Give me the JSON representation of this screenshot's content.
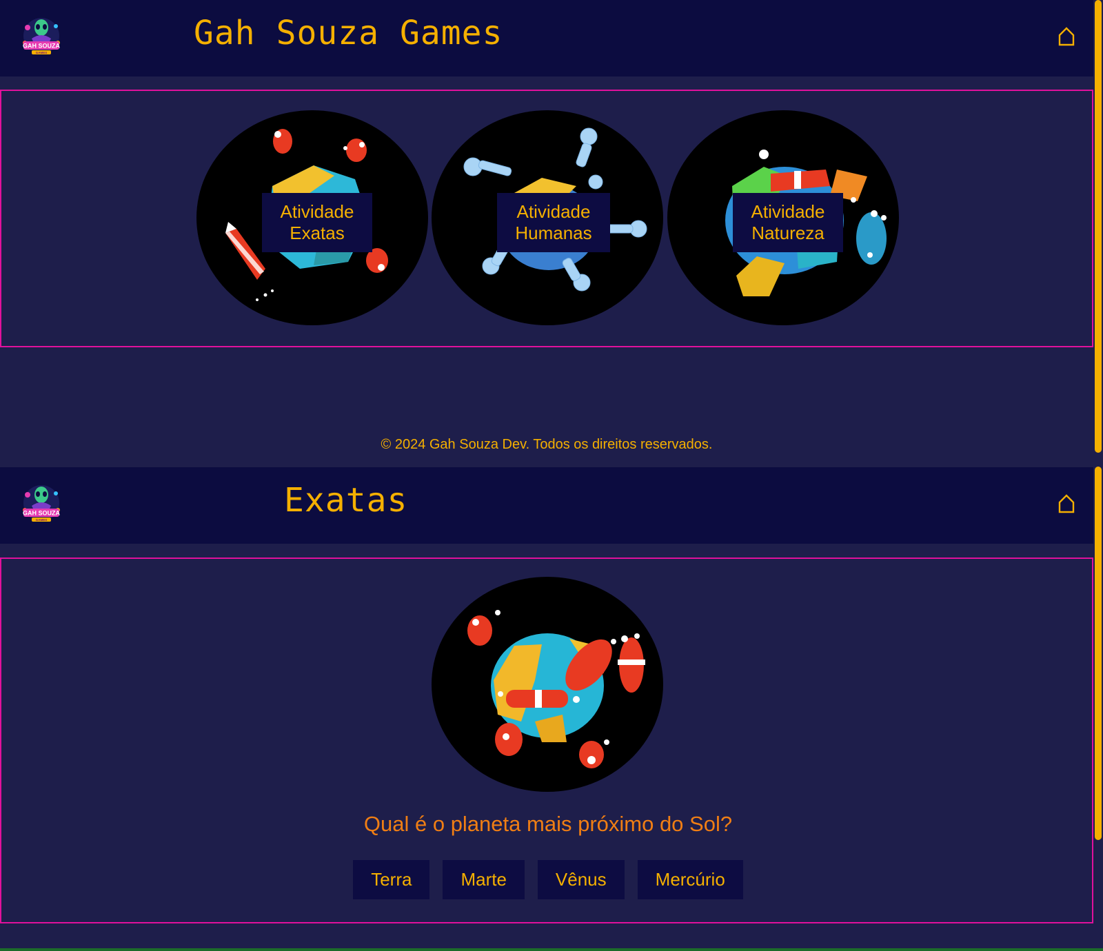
{
  "colors": {
    "accent": "#f5b000",
    "header_bg": "#0c0c40",
    "page_bg": "#1e1e4b",
    "panel_border": "#e0119c",
    "question": "#f07e14",
    "button_bg": "#0d0c42"
  },
  "home": {
    "logo_text": "GAH SOUZA",
    "logo_sub": "GAMES",
    "header": {
      "title": "Gah Souza Games",
      "home_icon": "home-icon"
    },
    "activities": [
      {
        "line1": "Atividade",
        "line2": "Exatas",
        "image": "planet-with-rockets"
      },
      {
        "line1": "Atividade",
        "line2": "Humanas",
        "image": "planet-with-astronauts"
      },
      {
        "line1": "Atividade",
        "line2": "Natureza",
        "image": "planet-with-fish-and-rockets"
      }
    ],
    "footer": "© 2024 Gah Souza Dev. Todos os direitos reservados."
  },
  "exatas": {
    "header": {
      "title": "Exatas",
      "home_icon": "home-icon"
    },
    "image": "planet-with-rockets",
    "question": "Qual é o planeta mais próximo do Sol?",
    "answers": [
      "Terra",
      "Marte",
      "Vênus",
      "Mercúrio"
    ]
  }
}
